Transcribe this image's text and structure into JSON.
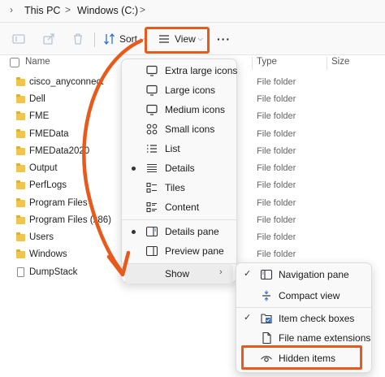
{
  "breadcrumb": {
    "items": [
      "This PC",
      "Windows (C:)"
    ],
    "separator": ">"
  },
  "toolbar": {
    "sort_label": "Sort",
    "view_label": "View",
    "more_label": "···"
  },
  "columns": {
    "name": "Name",
    "type": "Type",
    "size": "Size"
  },
  "files": [
    {
      "name": "cisco_anyconnect",
      "type": "File folder",
      "kind": "folder"
    },
    {
      "name": "Dell",
      "type": "File folder",
      "kind": "folder"
    },
    {
      "name": "FME",
      "type": "File folder",
      "kind": "folder"
    },
    {
      "name": "FMEData",
      "type": "File folder",
      "kind": "folder"
    },
    {
      "name": "FMEData2020",
      "type": "File folder",
      "kind": "folder"
    },
    {
      "name": "Output",
      "type": "File folder",
      "kind": "folder"
    },
    {
      "name": "PerfLogs",
      "type": "File folder",
      "kind": "folder"
    },
    {
      "name": "Program Files",
      "type": "File folder",
      "kind": "folder"
    },
    {
      "name": "Program Files (x86)",
      "type": "File folder",
      "kind": "folder"
    },
    {
      "name": "Users",
      "type": "File folder",
      "kind": "folder"
    },
    {
      "name": "Windows",
      "type": "File folder",
      "kind": "folder"
    },
    {
      "name": "DumpStack",
      "type": "",
      "kind": "file"
    }
  ],
  "view_menu": {
    "items": [
      {
        "label": "Extra large icons",
        "icon": "monitor-icon",
        "selected": false
      },
      {
        "label": "Large icons",
        "icon": "monitor-icon",
        "selected": false
      },
      {
        "label": "Medium icons",
        "icon": "monitor-icon",
        "selected": false
      },
      {
        "label": "Small icons",
        "icon": "grid-icon",
        "selected": false
      },
      {
        "label": "List",
        "icon": "list-icon",
        "selected": false
      },
      {
        "label": "Details",
        "icon": "details-icon",
        "selected": true
      },
      {
        "label": "Tiles",
        "icon": "tiles-icon",
        "selected": false
      },
      {
        "label": "Content",
        "icon": "content-icon",
        "selected": false
      },
      {
        "label": "Details pane",
        "icon": "details-pane-icon",
        "selected": true
      },
      {
        "label": "Preview pane",
        "icon": "preview-pane-icon",
        "selected": false
      },
      {
        "label": "Show",
        "icon": "",
        "selected": false
      }
    ]
  },
  "show_menu": {
    "items": [
      {
        "label": "Navigation pane",
        "icon": "navigation-pane-icon",
        "checked": true
      },
      {
        "label": "Compact view",
        "icon": "compact-view-icon",
        "checked": false
      },
      {
        "label": "Item check boxes",
        "icon": "check-boxes-icon",
        "checked": true
      },
      {
        "label": "File name extensions",
        "icon": "file-icon",
        "checked": false
      },
      {
        "label": "Hidden items",
        "icon": "eye-icon",
        "checked": false
      }
    ]
  },
  "colors": {
    "highlight": "#e8591c",
    "folder": "#f0c54f",
    "accent": "#2a6fd6"
  }
}
